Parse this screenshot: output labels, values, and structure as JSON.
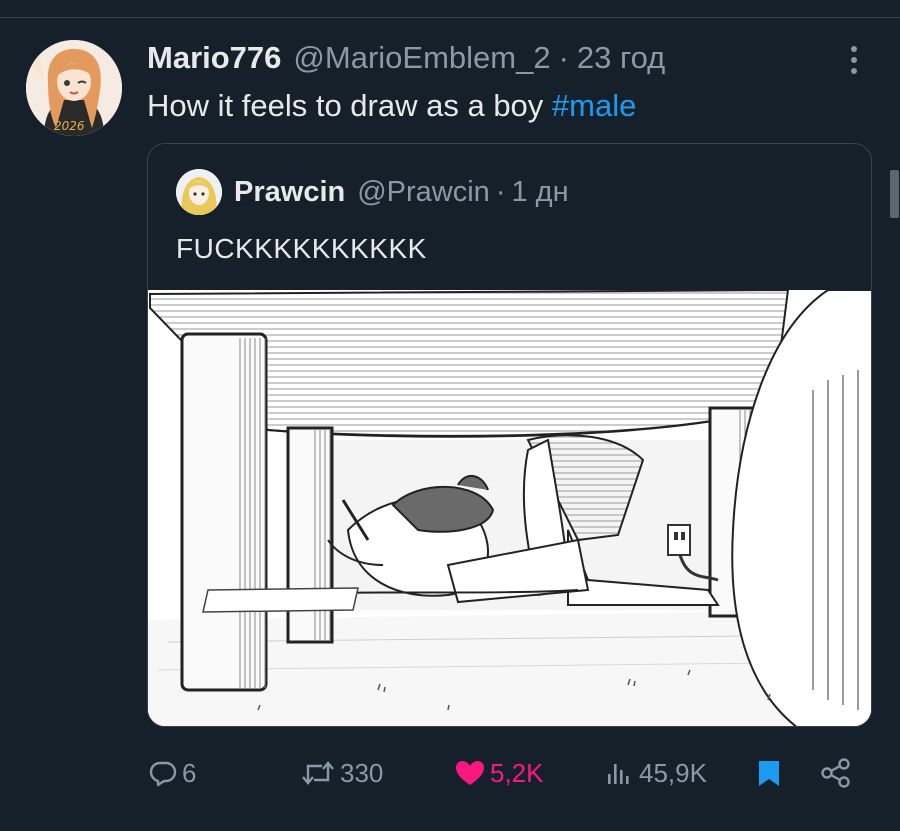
{
  "tweet": {
    "display_name": "Mario776",
    "handle": "@MarioEmblem_2",
    "separator": "·",
    "time": "23 год",
    "text": "How it feels to draw as a boy ",
    "hashtag": "#male"
  },
  "quoted_tweet": {
    "display_name": "Prawcin",
    "handle": "@Prawcin",
    "separator": "·",
    "time": "1 дн",
    "text": "FUCKKKKKKKKKK"
  },
  "actions": {
    "replies": "6",
    "retweets": "330",
    "likes": "5,2K",
    "views": "45,9K"
  },
  "colors": {
    "background": "#15202b",
    "text": "#e7e9ea",
    "secondary": "#8b98a5",
    "link": "#1d9bf0",
    "like_active": "#f91880"
  },
  "icons": {
    "more": "more-vertical-icon",
    "reply": "reply-icon",
    "retweet": "retweet-icon",
    "like": "heart-filled-icon",
    "views": "views-icon",
    "bookmark": "bookmark-filled-icon",
    "share": "share-icon"
  }
}
